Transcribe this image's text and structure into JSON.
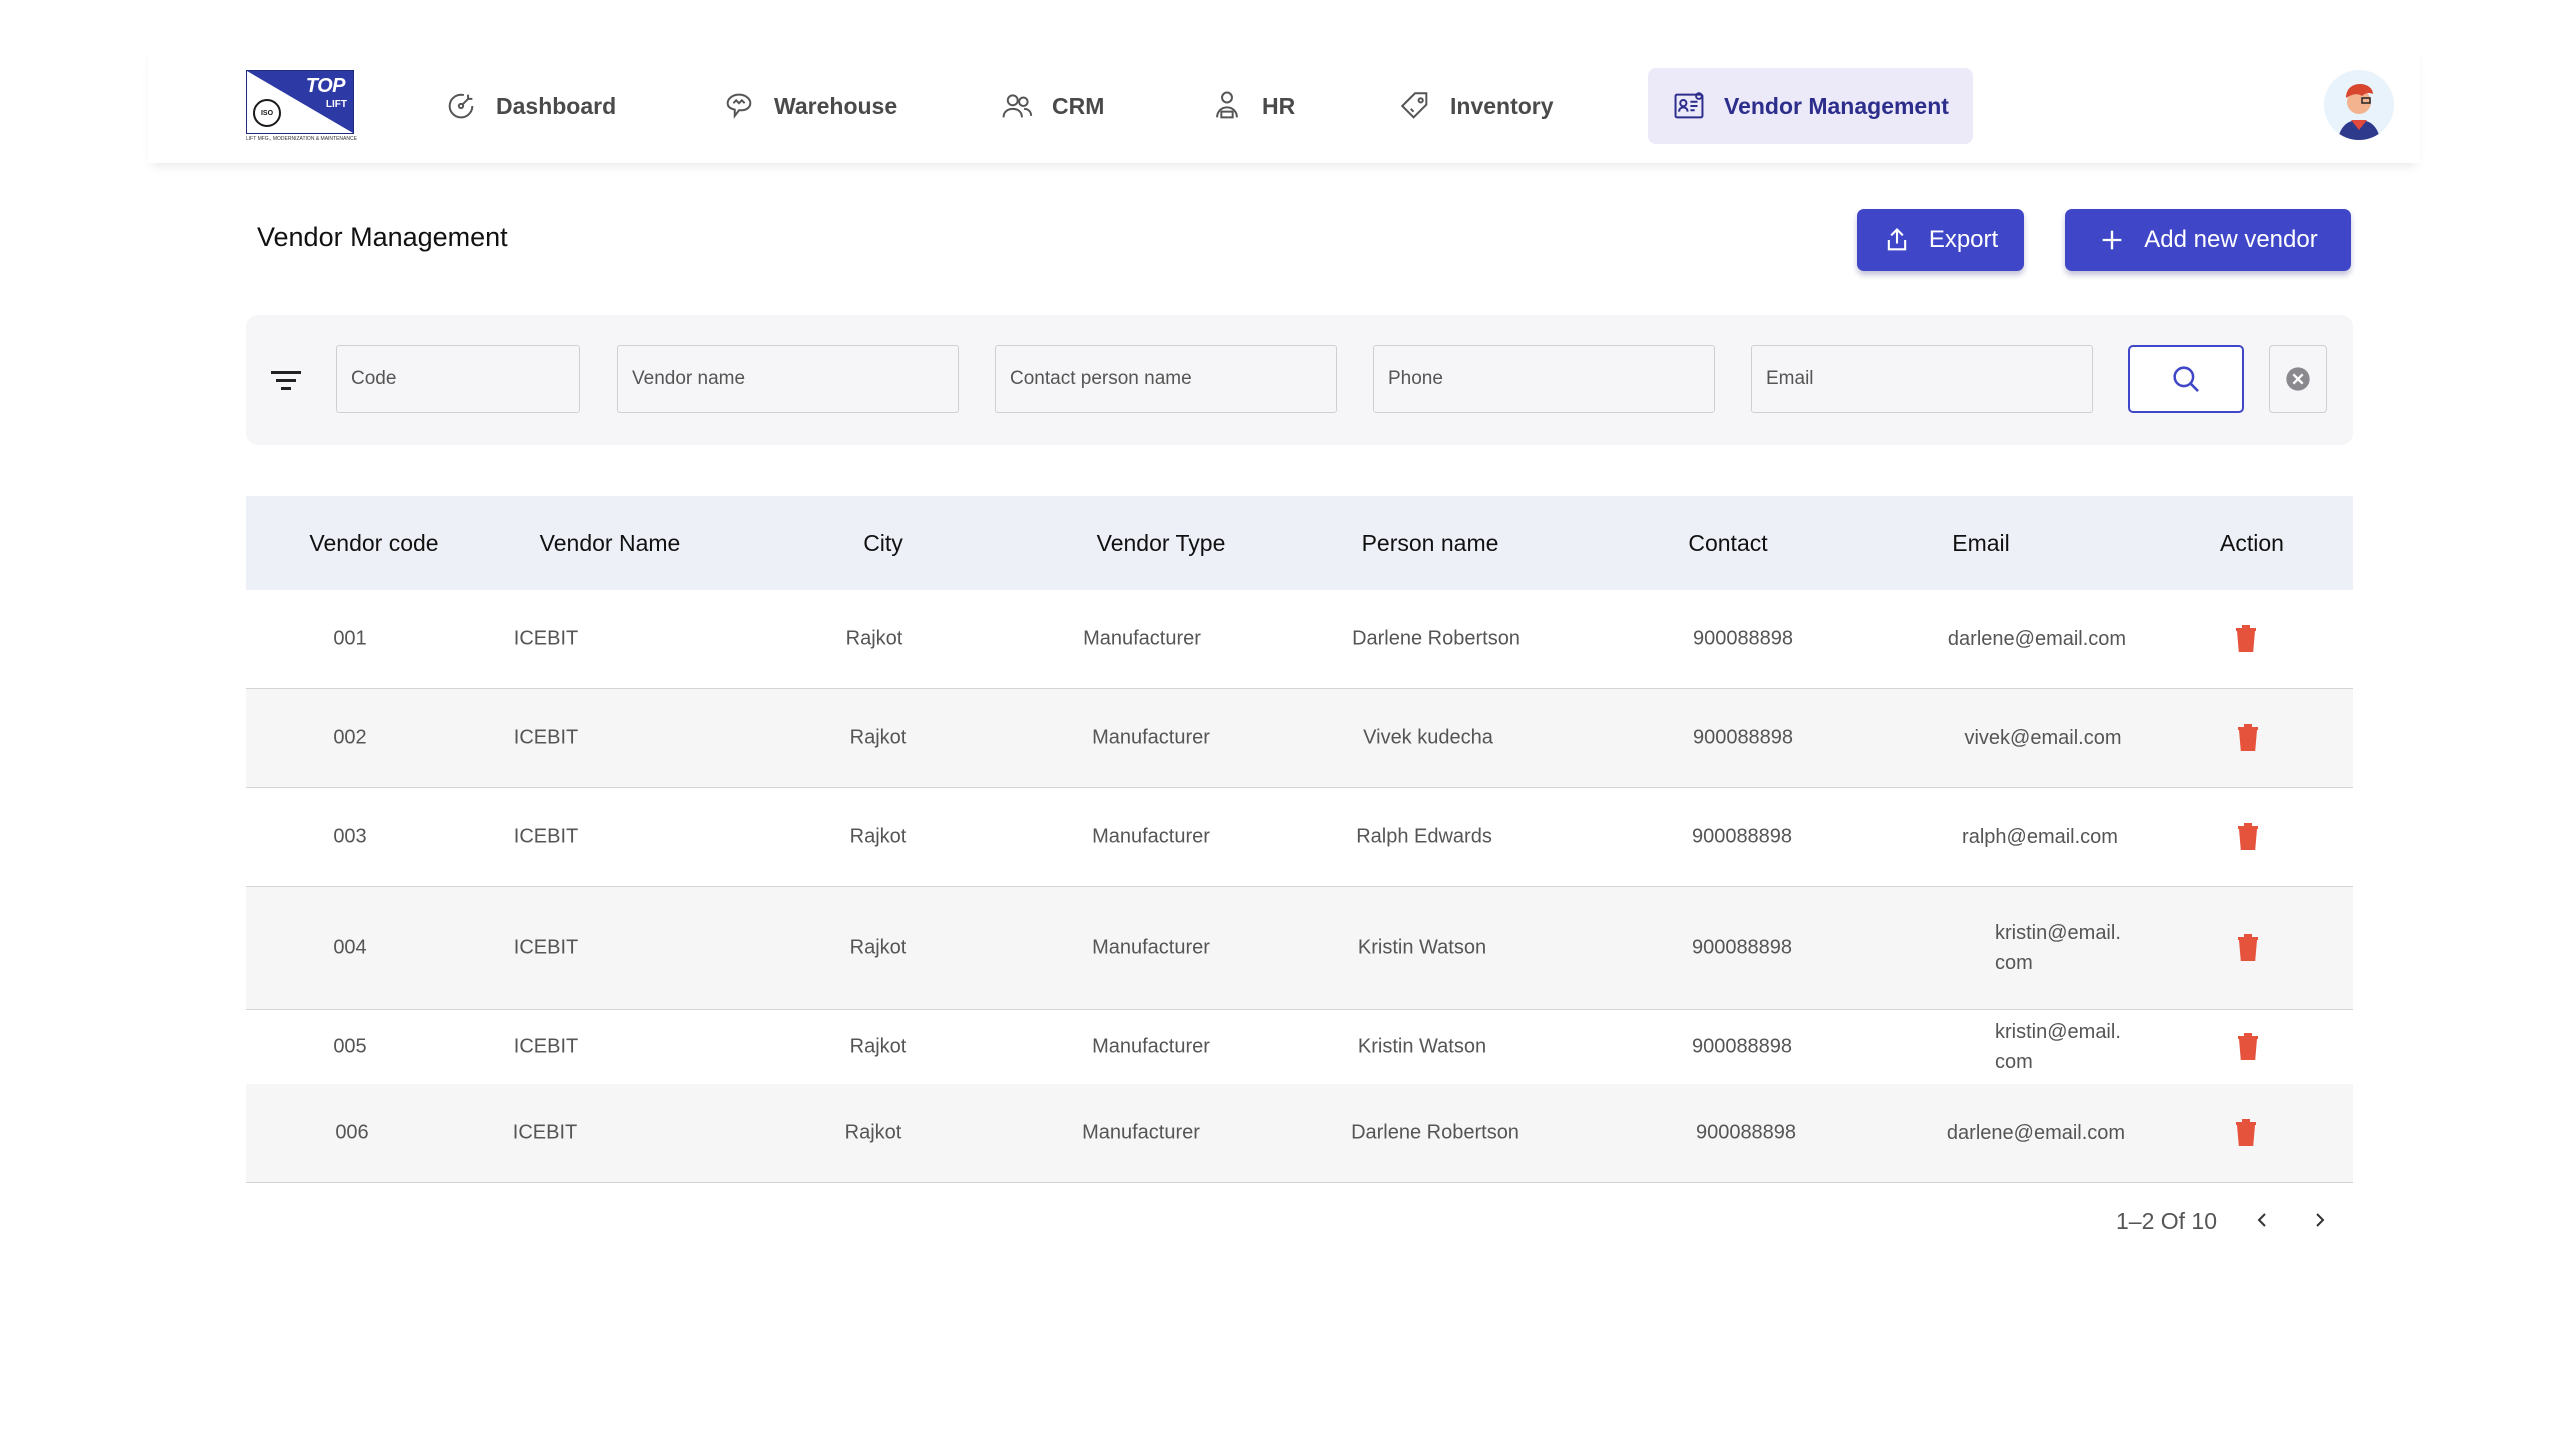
{
  "nav": {
    "logo": {
      "top": "TOP",
      "lift": "LIFT",
      "iso": "ISO",
      "tagline": "LIFT MFG., MODERNIZATION & MAINTENANCE"
    },
    "items": [
      {
        "label": "Dashboard",
        "icon": "dashboard-icon"
      },
      {
        "label": "Warehouse",
        "icon": "warehouse-icon"
      },
      {
        "label": "CRM",
        "icon": "crm-icon"
      },
      {
        "label": "HR",
        "icon": "hr-icon"
      },
      {
        "label": "Inventory",
        "icon": "inventory-icon"
      },
      {
        "label": "Vendor Management",
        "icon": "vendor-management-icon",
        "active": true
      }
    ]
  },
  "page": {
    "title": "Vendor Management",
    "export_label": "Export",
    "add_label": "Add new vendor"
  },
  "filters": {
    "code": "Code",
    "vendor_name": "Vendor name",
    "contact_person": "Contact person name",
    "phone": "Phone",
    "email": "Email"
  },
  "table": {
    "headers": [
      "Vendor code",
      "Vendor Name",
      "City",
      "Vendor Type",
      "Person name",
      "Contact",
      "Email",
      "Action"
    ],
    "rows": [
      {
        "code": "001",
        "name": "ICEBIT",
        "city": "Rajkot",
        "type": "Manufacturer",
        "person": "Darlene Robertson",
        "contact": "900088898",
        "email": "darlene@email.com"
      },
      {
        "code": "002",
        "name": "ICEBIT",
        "city": "Rajkot",
        "type": "Manufacturer",
        "person": "Vivek kudecha",
        "contact": "900088898",
        "email": "vivek@email.com"
      },
      {
        "code": "003",
        "name": "ICEBIT",
        "city": "Rajkot",
        "type": "Manufacturer",
        "person": "Ralph Edwards",
        "contact": "900088898",
        "email": "ralph@email.com"
      },
      {
        "code": "004",
        "name": "ICEBIT",
        "city": "Rajkot",
        "type": "Manufacturer",
        "person": "Kristin Watson",
        "contact": "900088898",
        "email": "kristin@email. com"
      },
      {
        "code": "005",
        "name": "ICEBIT",
        "city": "Rajkot",
        "type": "Manufacturer",
        "person": "Kristin Watson",
        "contact": "900088898",
        "email": "kristin@email. com"
      },
      {
        "code": "006",
        "name": "ICEBIT",
        "city": "Rajkot",
        "type": "Manufacturer",
        "person": "Darlene Robertson",
        "contact": "900088898",
        "email": "darlene@email.com"
      }
    ]
  },
  "pagination": {
    "label": "1–2 Of 10"
  },
  "colors": {
    "primary": "#3f46c8",
    "active_nav_bg": "#eceaf9",
    "delete": "#e5533d",
    "header_bg": "#eef0f8"
  }
}
